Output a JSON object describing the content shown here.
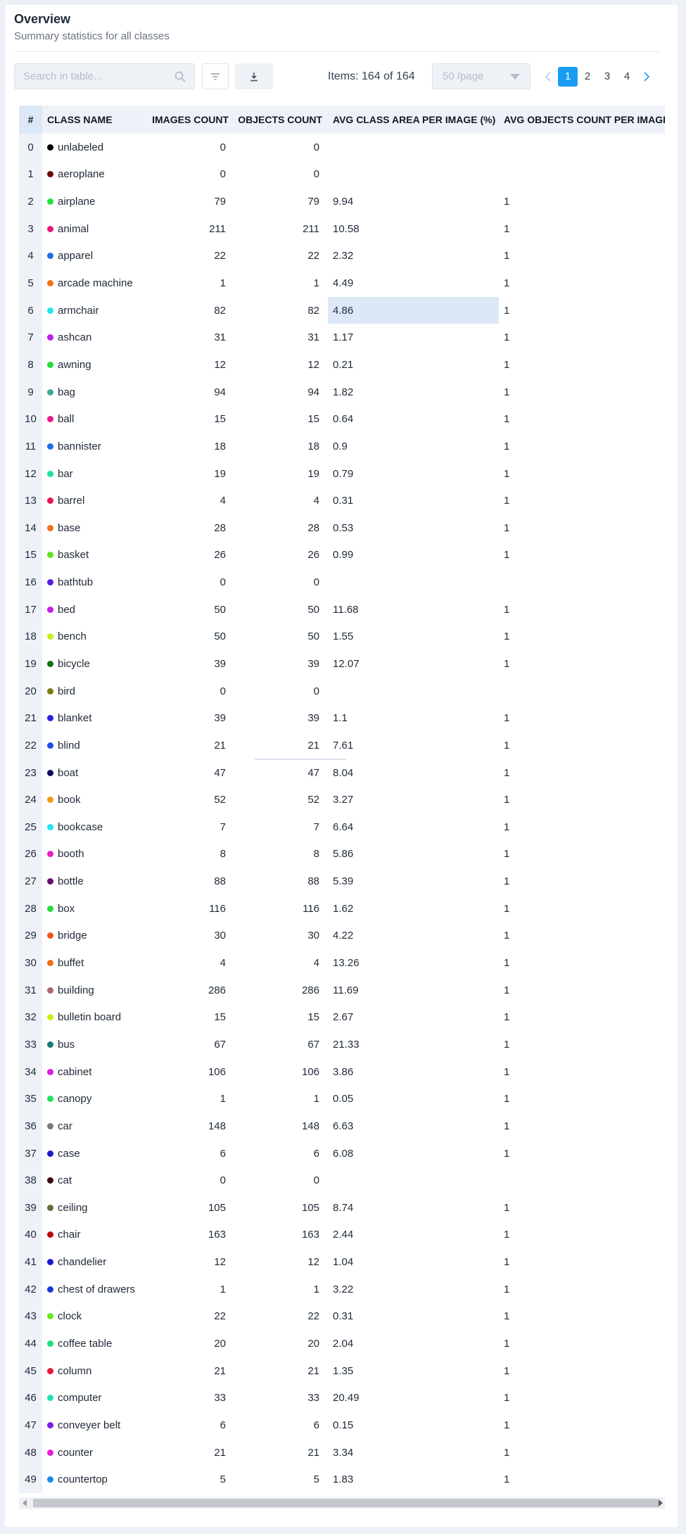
{
  "header": {
    "title": "Overview",
    "subtitle": "Summary statistics for all classes"
  },
  "toolbar": {
    "search_placeholder": "Search in table...",
    "items_text": "Items: 164 of 164",
    "page_size": "50 /page",
    "pages": [
      "1",
      "2",
      "3",
      "4"
    ],
    "active_page": "1"
  },
  "icons": {
    "search": "search-icon",
    "filter": "filter-icon",
    "download": "download-icon",
    "prev": "chevron-left-icon",
    "next": "chevron-right-icon"
  },
  "colors": {
    "accent": "#1a9cf5",
    "highlight": "#dde8f6"
  },
  "table": {
    "columns": [
      "#",
      "CLASS NAME",
      "IMAGES COUNT",
      "OBJECTS COUNT",
      "AVG CLASS AREA PER IMAGE (%)",
      "AVG OBJECTS COUNT PER IMAGE"
    ],
    "highlighted_cell": {
      "row": 6,
      "column": 4
    },
    "rows": [
      {
        "idx": "0",
        "name": "unlabeled",
        "color": "#000000",
        "images": "0",
        "objects": "0",
        "area": "",
        "avg": ""
      },
      {
        "idx": "1",
        "name": "aeroplane",
        "color": "#6b0a0a",
        "images": "0",
        "objects": "0",
        "area": "",
        "avg": ""
      },
      {
        "idx": "2",
        "name": "airplane",
        "color": "#22e03c",
        "images": "79",
        "objects": "79",
        "area": "9.94",
        "avg": "1"
      },
      {
        "idx": "3",
        "name": "animal",
        "color": "#e8177a",
        "images": "211",
        "objects": "211",
        "area": "10.58",
        "avg": "1"
      },
      {
        "idx": "4",
        "name": "apparel",
        "color": "#1f6ee8",
        "images": "22",
        "objects": "22",
        "area": "2.32",
        "avg": "1"
      },
      {
        "idx": "5",
        "name": "arcade machine",
        "color": "#f26f16",
        "images": "1",
        "objects": "1",
        "area": "4.49",
        "avg": "1"
      },
      {
        "idx": "6",
        "name": "armchair",
        "color": "#23e6e6",
        "images": "82",
        "objects": "82",
        "area": "4.86",
        "avg": "1"
      },
      {
        "idx": "7",
        "name": "ashcan",
        "color": "#b81ee6",
        "images": "31",
        "objects": "31",
        "area": "1.17",
        "avg": "1"
      },
      {
        "idx": "8",
        "name": "awning",
        "color": "#22e03c",
        "images": "12",
        "objects": "12",
        "area": "0.21",
        "avg": "1"
      },
      {
        "idx": "9",
        "name": "bag",
        "color": "#3fa89a",
        "images": "94",
        "objects": "94",
        "area": "1.82",
        "avg": "1"
      },
      {
        "idx": "10",
        "name": "ball",
        "color": "#ea1a8a",
        "images": "15",
        "objects": "15",
        "area": "0.64",
        "avg": "1"
      },
      {
        "idx": "11",
        "name": "bannister",
        "color": "#1f6ee8",
        "images": "18",
        "objects": "18",
        "area": "0.9",
        "avg": "1"
      },
      {
        "idx": "12",
        "name": "bar",
        "color": "#20e0a0",
        "images": "19",
        "objects": "19",
        "area": "0.79",
        "avg": "1"
      },
      {
        "idx": "13",
        "name": "barrel",
        "color": "#e8174e",
        "images": "4",
        "objects": "4",
        "area": "0.31",
        "avg": "1"
      },
      {
        "idx": "14",
        "name": "base",
        "color": "#f26f16",
        "images": "28",
        "objects": "28",
        "area": "0.53",
        "avg": "1"
      },
      {
        "idx": "15",
        "name": "basket",
        "color": "#5ae61e",
        "images": "26",
        "objects": "26",
        "area": "0.99",
        "avg": "1"
      },
      {
        "idx": "16",
        "name": "bathtub",
        "color": "#5a1ee6",
        "images": "0",
        "objects": "0",
        "area": "",
        "avg": ""
      },
      {
        "idx": "17",
        "name": "bed",
        "color": "#c41ee6",
        "images": "50",
        "objects": "50",
        "area": "11.68",
        "avg": "1"
      },
      {
        "idx": "18",
        "name": "bench",
        "color": "#c8f01a",
        "images": "50",
        "objects": "50",
        "area": "1.55",
        "avg": "1"
      },
      {
        "idx": "19",
        "name": "bicycle",
        "color": "#1a6b1a",
        "images": "39",
        "objects": "39",
        "area": "12.07",
        "avg": "1"
      },
      {
        "idx": "20",
        "name": "bird",
        "color": "#7a7a10",
        "images": "0",
        "objects": "0",
        "area": "",
        "avg": ""
      },
      {
        "idx": "21",
        "name": "blanket",
        "color": "#2a1ee6",
        "images": "39",
        "objects": "39",
        "area": "1.1",
        "avg": "1"
      },
      {
        "idx": "22",
        "name": "blind",
        "color": "#1f4fe8",
        "images": "21",
        "objects": "21",
        "area": "7.61",
        "avg": "1"
      },
      {
        "idx": "23",
        "name": "boat",
        "color": "#0a0a5a",
        "images": "47",
        "objects": "47",
        "area": "8.04",
        "avg": "1"
      },
      {
        "idx": "24",
        "name": "book",
        "color": "#f29a16",
        "images": "52",
        "objects": "52",
        "area": "3.27",
        "avg": "1"
      },
      {
        "idx": "25",
        "name": "bookcase",
        "color": "#23e6f0",
        "images": "7",
        "objects": "7",
        "area": "6.64",
        "avg": "1"
      },
      {
        "idx": "26",
        "name": "booth",
        "color": "#e81ec4",
        "images": "8",
        "objects": "8",
        "area": "5.86",
        "avg": "1"
      },
      {
        "idx": "27",
        "name": "bottle",
        "color": "#6b0a6b",
        "images": "88",
        "objects": "88",
        "area": "5.39",
        "avg": "1"
      },
      {
        "idx": "28",
        "name": "box",
        "color": "#22e03c",
        "images": "116",
        "objects": "116",
        "area": "1.62",
        "avg": "1"
      },
      {
        "idx": "29",
        "name": "bridge",
        "color": "#f2561e",
        "images": "30",
        "objects": "30",
        "area": "4.22",
        "avg": "1"
      },
      {
        "idx": "30",
        "name": "buffet",
        "color": "#f26f16",
        "images": "4",
        "objects": "4",
        "area": "13.26",
        "avg": "1"
      },
      {
        "idx": "31",
        "name": "building",
        "color": "#a86a6a",
        "images": "286",
        "objects": "286",
        "area": "11.69",
        "avg": "1"
      },
      {
        "idx": "32",
        "name": "bulletin board",
        "color": "#c8f01a",
        "images": "15",
        "objects": "15",
        "area": "2.67",
        "avg": "1"
      },
      {
        "idx": "33",
        "name": "bus",
        "color": "#1a7a7a",
        "images": "67",
        "objects": "67",
        "area": "21.33",
        "avg": "1"
      },
      {
        "idx": "34",
        "name": "cabinet",
        "color": "#d61ee6",
        "images": "106",
        "objects": "106",
        "area": "3.86",
        "avg": "1"
      },
      {
        "idx": "35",
        "name": "canopy",
        "color": "#20e060",
        "images": "1",
        "objects": "1",
        "area": "0.05",
        "avg": "1"
      },
      {
        "idx": "36",
        "name": "car",
        "color": "#7a7a7a",
        "images": "148",
        "objects": "148",
        "area": "6.63",
        "avg": "1"
      },
      {
        "idx": "37",
        "name": "case",
        "color": "#1a1ac8",
        "images": "6",
        "objects": "6",
        "area": "6.08",
        "avg": "1"
      },
      {
        "idx": "38",
        "name": "cat",
        "color": "#3a0a0a",
        "images": "0",
        "objects": "0",
        "area": "",
        "avg": ""
      },
      {
        "idx": "39",
        "name": "ceiling",
        "color": "#6b6b3a",
        "images": "105",
        "objects": "105",
        "area": "8.74",
        "avg": "1"
      },
      {
        "idx": "40",
        "name": "chair",
        "color": "#b80a0a",
        "images": "163",
        "objects": "163",
        "area": "2.44",
        "avg": "1"
      },
      {
        "idx": "41",
        "name": "chandelier",
        "color": "#1a1ad6",
        "images": "12",
        "objects": "12",
        "area": "1.04",
        "avg": "1"
      },
      {
        "idx": "42",
        "name": "chest of drawers",
        "color": "#1a3ad6",
        "images": "1",
        "objects": "1",
        "area": "3.22",
        "avg": "1"
      },
      {
        "idx": "43",
        "name": "clock",
        "color": "#6ae61e",
        "images": "22",
        "objects": "22",
        "area": "0.31",
        "avg": "1"
      },
      {
        "idx": "44",
        "name": "coffee table",
        "color": "#20e080",
        "images": "20",
        "objects": "20",
        "area": "2.04",
        "avg": "1"
      },
      {
        "idx": "45",
        "name": "column",
        "color": "#e8173a",
        "images": "21",
        "objects": "21",
        "area": "1.35",
        "avg": "1"
      },
      {
        "idx": "46",
        "name": "computer",
        "color": "#20e0b4",
        "images": "33",
        "objects": "33",
        "area": "20.49",
        "avg": "1"
      },
      {
        "idx": "47",
        "name": "conveyer belt",
        "color": "#7a1ee6",
        "images": "6",
        "objects": "6",
        "area": "0.15",
        "avg": "1"
      },
      {
        "idx": "48",
        "name": "counter",
        "color": "#e81ed6",
        "images": "21",
        "objects": "21",
        "area": "3.34",
        "avg": "1"
      },
      {
        "idx": "49",
        "name": "countertop",
        "color": "#1a8ae8",
        "images": "5",
        "objects": "5",
        "area": "1.83",
        "avg": "1"
      }
    ]
  }
}
